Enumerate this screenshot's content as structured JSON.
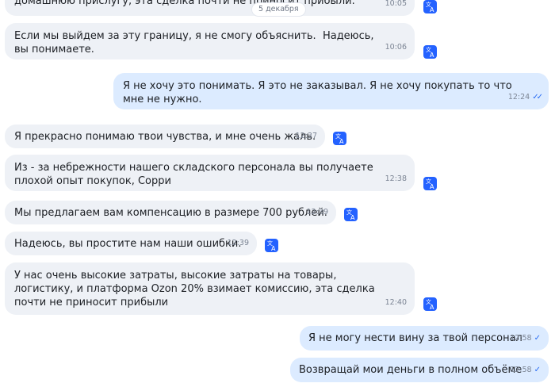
{
  "date_separator": "5 декабря",
  "messages": [
    {
      "direction": "in",
      "text": "домашнюю прислугу, эта сделка почти не приносит прибыли.",
      "time": "10:05",
      "translate_icon": "translate-icon"
    },
    {
      "direction": "in",
      "text": "Если мы выйдем за эту границу, я не смогу объяснить.  Надеюсь, вы понимаете.",
      "time": "10:06",
      "translate_icon": "translate-icon"
    },
    {
      "direction": "out",
      "text": "Я не хочу это понимать. Я это не заказывал. Я не хочу покупать то что мне не нужно.",
      "time": "12:24",
      "status": "read"
    },
    {
      "direction": "in",
      "text": "Я прекрасно понимаю твои чувства, и мне очень жаль.",
      "time": "12:37",
      "translate_icon": "translate-icon"
    },
    {
      "direction": "in",
      "text": "Из - за небрежности нашего складского персонала вы получаете плохой опыт покупок, Сорри",
      "time": "12:38",
      "translate_icon": "translate-icon"
    },
    {
      "direction": "in",
      "text": "Мы предлагаем вам компенсацию в размере 700 рублей.",
      "time": "12:39",
      "translate_icon": "translate-icon"
    },
    {
      "direction": "in",
      "text": "Надеюсь, вы простите нам наши ошибки.",
      "time": "12:39",
      "translate_icon": "translate-icon"
    },
    {
      "direction": "in",
      "text": "У нас очень высокие затраты, высокие затраты на товары, логистику, и платформа Ozon 20% взимает комиссию, эта сделка почти не приносит прибыли",
      "time": "12:40",
      "translate_icon": "translate-icon"
    },
    {
      "direction": "out",
      "text": "Я не могу нести вину за твой персонал",
      "time": "12:58",
      "status": "delivered"
    },
    {
      "direction": "out",
      "text": "Возвращай мои деньги в полном объёме",
      "time": "12:58",
      "status": "delivered"
    }
  ],
  "colors": {
    "incoming_bubble": "#eef1f6",
    "outgoing_bubble": "#dcebff",
    "accent": "#2462ff"
  }
}
